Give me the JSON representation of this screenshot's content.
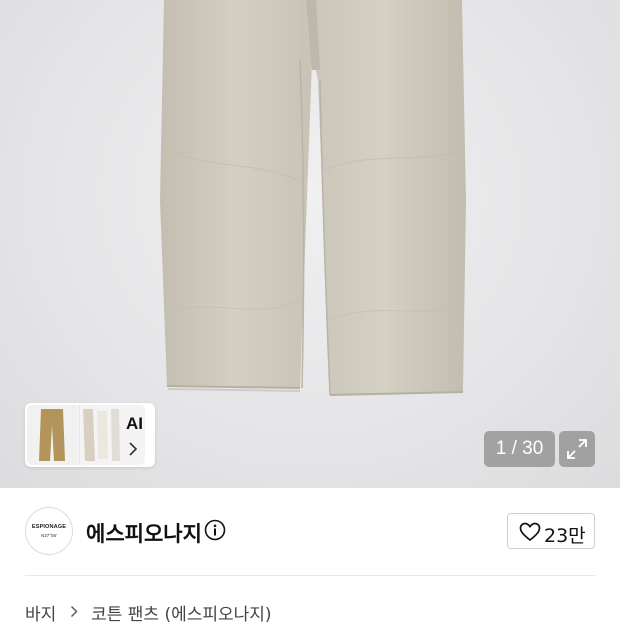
{
  "gallery": {
    "counter": "1 / 30",
    "ai_label": "AI"
  },
  "brand": {
    "logo_text_line1": "ESPIONAGE",
    "logo_text_line2": "N37°56'",
    "name": "에스피오나지"
  },
  "like": {
    "count": "23만"
  },
  "breadcrumb": {
    "items": [
      "바지",
      "코튼 팬츠 (에스피오나지)"
    ]
  },
  "icons": {
    "ai_chevron": "chevron-right-icon",
    "expand": "expand-icon",
    "info": "info-icon",
    "heart": "heart-icon",
    "breadcrumb_sep": "chevron-right-icon"
  },
  "colors": {
    "pants": "#cfcbbf",
    "text": "#111111",
    "overlay": "#6e6e6e"
  }
}
